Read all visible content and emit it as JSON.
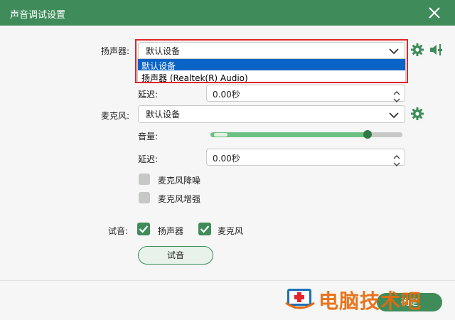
{
  "window": {
    "title": "声音调试设置"
  },
  "speaker": {
    "label": "扬声器:",
    "selected": "默认设备",
    "options": [
      "默认设备",
      "扬声器 (Realtek(R) Audio)"
    ],
    "delay_label": "延迟:",
    "delay_value": "0.00秒"
  },
  "mic": {
    "label": "麦克风:",
    "selected": "默认设备",
    "volume_label": "音量:",
    "volume_level": 0.82,
    "volume_buffer": 0.07,
    "delay_label": "延迟:",
    "delay_value": "0.00秒",
    "noise_reduction": {
      "label": "麦克风降噪",
      "checked": false
    },
    "enhance": {
      "label": "麦克风增强",
      "checked": false
    }
  },
  "test": {
    "label": "试音:",
    "speaker": {
      "label": "扬声器",
      "checked": true
    },
    "mic": {
      "label": "麦克风",
      "checked": true
    },
    "button_label": "试音"
  },
  "footer": {
    "confirm_label": "确定"
  },
  "watermark": {
    "text": "电脑技术吧"
  },
  "colors": {
    "accent": "#3f8c5a",
    "highlight": "#e0262b",
    "selection": "#0a63c6",
    "slider_fill": "#6cc182",
    "watermark": "#e86a0c"
  },
  "icons": [
    "close-icon",
    "chevron-down-icon",
    "gear-icon",
    "speaker-volume-icon",
    "chevron-up-icon",
    "check-icon"
  ]
}
